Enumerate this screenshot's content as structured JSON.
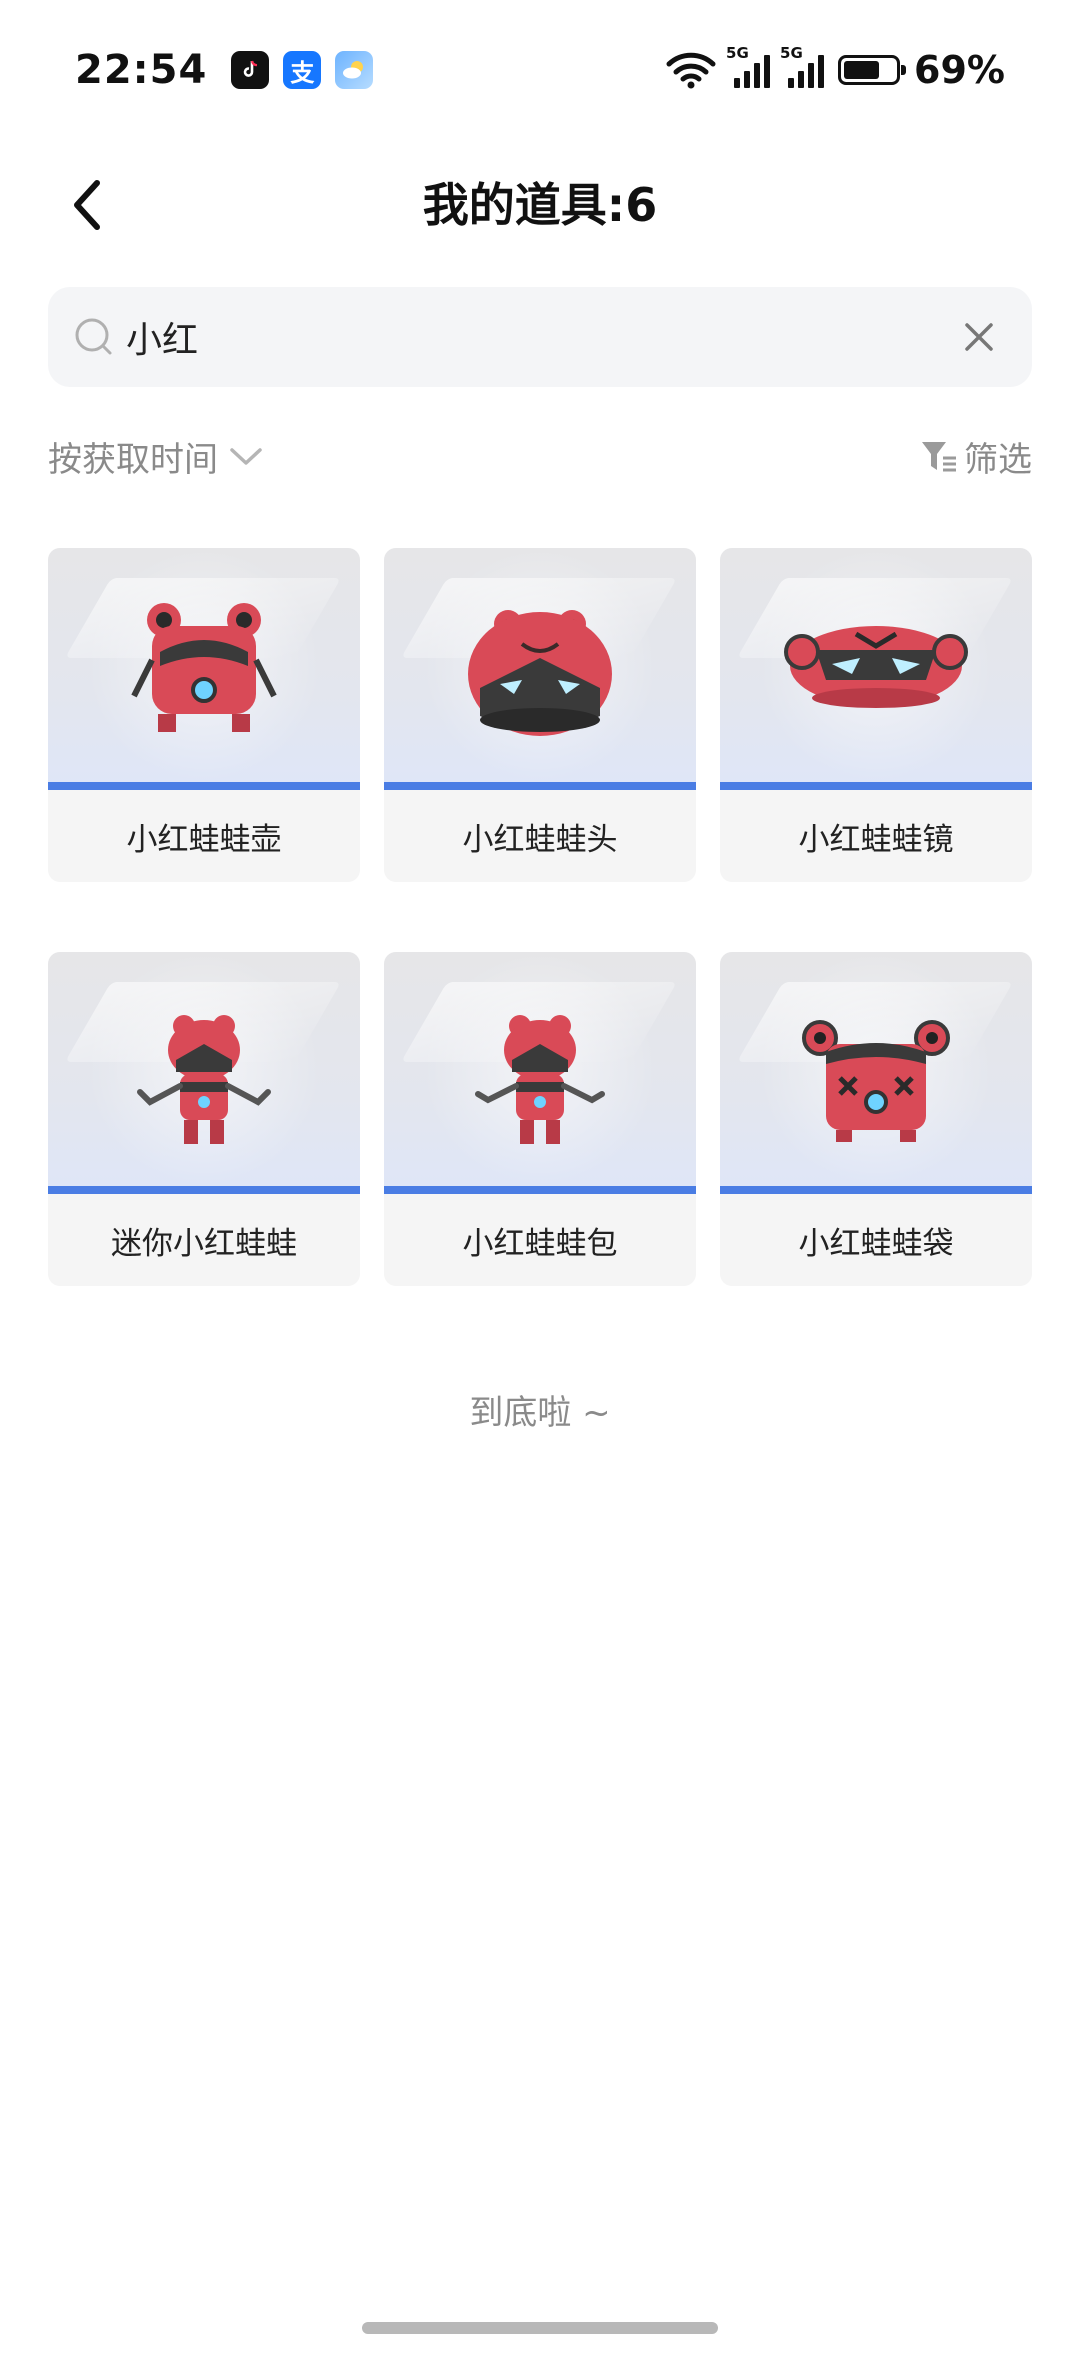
{
  "status_bar": {
    "time": "22:54",
    "apps": [
      "tiktok-icon",
      "alipay-icon",
      "weather-icon"
    ],
    "alipay_glyph": "支",
    "signal1_label": "5G",
    "signal2_label": "5G",
    "battery_level": 0.69,
    "battery_pct": "69%"
  },
  "header": {
    "title": "我的道具:6"
  },
  "search": {
    "value": "小红"
  },
  "sort": {
    "label": "按获取时间"
  },
  "filter": {
    "label": "筛选"
  },
  "items": [
    {
      "name": "小红蛙蛙壶"
    },
    {
      "name": "小红蛙蛙头"
    },
    {
      "name": "小红蛙蛙镜"
    },
    {
      "name": "迷你小红蛙蛙"
    },
    {
      "name": "小红蛙蛙包"
    },
    {
      "name": "小红蛙蛙袋"
    }
  ],
  "footer": {
    "end_text": "到底啦 ~"
  },
  "colors": {
    "accent_blue": "#4a7de4",
    "item_red": "#d94a57",
    "dark": "#3a3a3a"
  }
}
